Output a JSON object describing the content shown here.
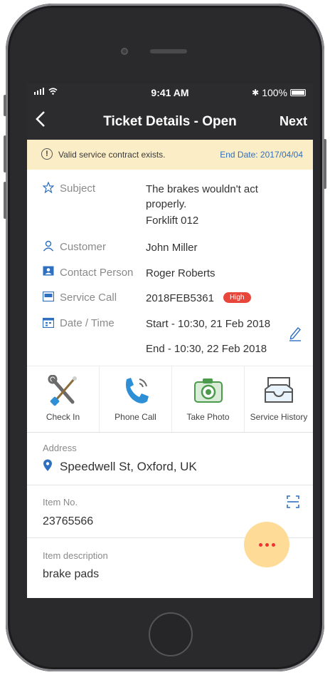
{
  "status_bar": {
    "time": "9:41 AM",
    "battery": "100%"
  },
  "nav": {
    "back_icon": "chevron-left-icon",
    "title": "Ticket Details - Open",
    "next_label": "Next"
  },
  "banner": {
    "message": "Valid service contract exists.",
    "end_date": "End Date: 2017/04/04"
  },
  "details": {
    "subject_label": "Subject",
    "subject_line1": "The brakes wouldn't act",
    "subject_line2": "properly.",
    "subject_line3": "Forklift 012",
    "customer_label": "Customer",
    "customer_value": "John Miller",
    "contact_label": "Contact Person",
    "contact_value": "Roger Roberts",
    "service_call_label": "Service Call",
    "service_call_value": "2018FEB5361",
    "priority_badge": "High",
    "datetime_label": "Date / Time",
    "start": "Start - 10:30, 21 Feb 2018",
    "end": "End - 10:30, 22 Feb 2018"
  },
  "actions": [
    {
      "label": "Check In",
      "icon": "tools-icon"
    },
    {
      "label": "Phone Call",
      "icon": "phone-icon"
    },
    {
      "label": "Take Photo",
      "icon": "camera-icon"
    },
    {
      "label": "Service History",
      "icon": "inbox-icon"
    }
  ],
  "address": {
    "label": "Address",
    "value": "Speedwell St, Oxford, UK"
  },
  "item_no": {
    "label": "Item No.",
    "value": "23765566"
  },
  "item_description": {
    "label": "Item description",
    "value": "brake pads"
  },
  "colors": {
    "accent": "#2e6fbf",
    "banner_bg": "#fbedc6",
    "badge": "#e8463a",
    "fab": "#ffdb98",
    "bar": "#2c2c2e"
  }
}
